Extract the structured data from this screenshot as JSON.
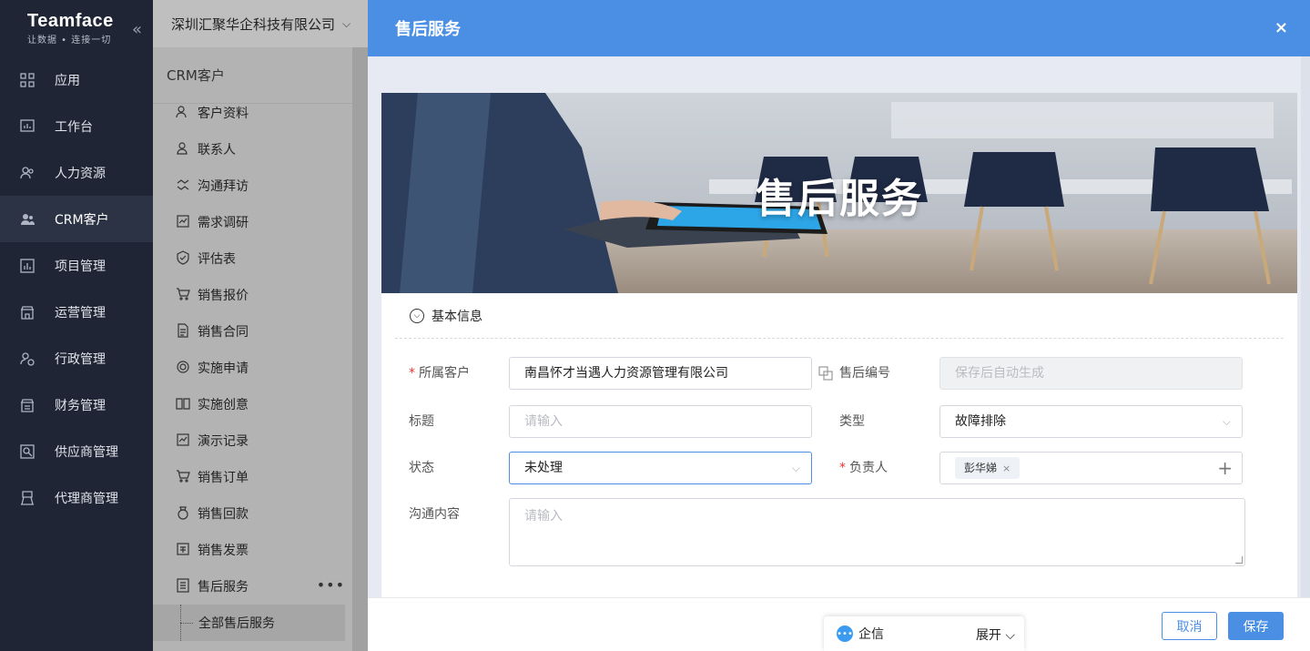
{
  "brand": {
    "name": "Teamface",
    "tagline": "让数据 • 连接一切"
  },
  "nav": {
    "items": [
      {
        "label": "应用",
        "icon": "apps-icon"
      },
      {
        "label": "工作台",
        "icon": "workbench-icon"
      },
      {
        "label": "人力资源",
        "icon": "hr-icon"
      },
      {
        "label": "CRM客户",
        "icon": "crm-icon",
        "active": true
      },
      {
        "label": "项目管理",
        "icon": "project-icon"
      },
      {
        "label": "运营管理",
        "icon": "operations-icon"
      },
      {
        "label": "行政管理",
        "icon": "admin-icon"
      },
      {
        "label": "财务管理",
        "icon": "finance-icon"
      },
      {
        "label": "供应商管理",
        "icon": "supplier-icon"
      },
      {
        "label": "代理商管理",
        "icon": "agent-icon"
      }
    ]
  },
  "company": {
    "name": "深圳汇聚华企科技有限公司"
  },
  "subnav": {
    "title": "CRM客户",
    "items": [
      {
        "label": "客户资料",
        "icon": "customer-icon"
      },
      {
        "label": "联系人",
        "icon": "contact-icon"
      },
      {
        "label": "沟通拜访",
        "icon": "visit-icon"
      },
      {
        "label": "需求调研",
        "icon": "research-icon"
      },
      {
        "label": "评估表",
        "icon": "evaluation-icon"
      },
      {
        "label": "销售报价",
        "icon": "quote-icon"
      },
      {
        "label": "销售合同",
        "icon": "contract-icon"
      },
      {
        "label": "实施申请",
        "icon": "apply-icon"
      },
      {
        "label": "实施创意",
        "icon": "idea-icon"
      },
      {
        "label": "演示记录",
        "icon": "demo-icon"
      },
      {
        "label": "销售订单",
        "icon": "order-icon"
      },
      {
        "label": "销售回款",
        "icon": "payment-icon"
      },
      {
        "label": "销售发票",
        "icon": "invoice-icon"
      },
      {
        "label": "售后服务",
        "icon": "service-icon"
      }
    ],
    "child": "全部售后服务",
    "more": "•••"
  },
  "modal": {
    "title": "售后服务",
    "close": "×",
    "banner_title": "售后服务",
    "section": "基本信息",
    "fields": {
      "customer": {
        "label": "所属客户",
        "value": "南昌怀才当遇人力资源管理有限公司",
        "required": true
      },
      "service_no": {
        "label": "售后编号",
        "placeholder": "保存后自动生成"
      },
      "title": {
        "label": "标题",
        "placeholder": "请输入"
      },
      "type": {
        "label": "类型",
        "value": "故障排除"
      },
      "status": {
        "label": "状态",
        "value": "未处理"
      },
      "owner": {
        "label": "负责人",
        "tag": "彭华娣",
        "required": true
      },
      "content": {
        "label": "沟通内容",
        "placeholder": "请输入"
      }
    },
    "buttons": {
      "cancel": "取消",
      "save": "保存"
    }
  },
  "chat": {
    "label": "企信",
    "expand": "展开"
  }
}
